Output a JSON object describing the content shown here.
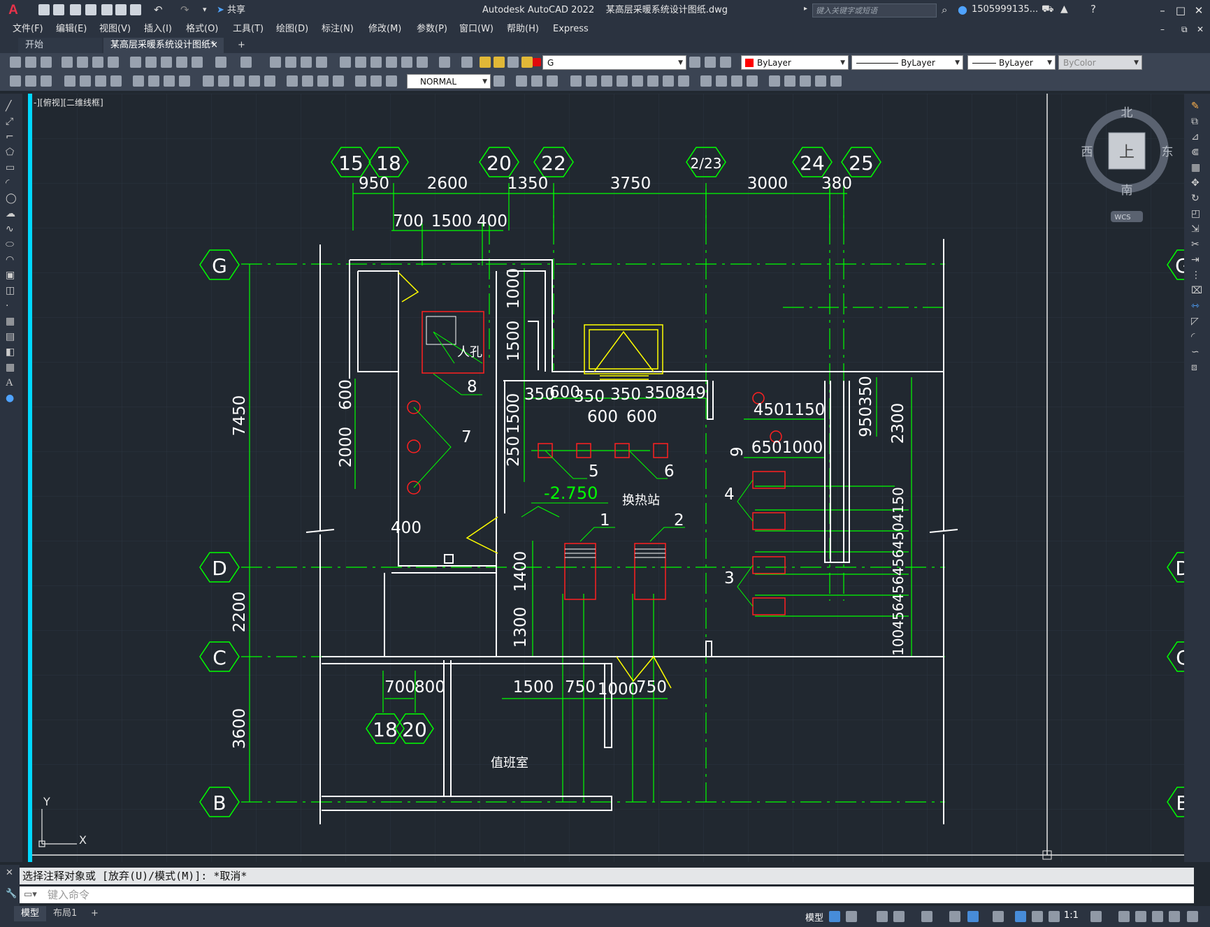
{
  "titlebar": {
    "app_title": "Autodesk AutoCAD 2022",
    "file_title": "某高层采暖系统设计图纸.dwg",
    "share_label": "共享",
    "search_placeholder": "键入关键字或短语",
    "user_name": "1505999135...",
    "app_logo": "A"
  },
  "menu": [
    "文件(F)",
    "编辑(E)",
    "视图(V)",
    "插入(I)",
    "格式(O)",
    "工具(T)",
    "绘图(D)",
    "标注(N)",
    "修改(M)",
    "参数(P)",
    "窗口(W)",
    "帮助(H)",
    "Express"
  ],
  "tabs": {
    "start": "开始",
    "active": "某高层采暖系统设计图纸*",
    "close": "×",
    "add": "+"
  },
  "toolbar": {
    "layer_value": "G",
    "color_value": "ByLayer",
    "linetype_value": "ByLayer",
    "lineweight_value": "ByLayer",
    "plotstyle_value": "ByColor",
    "dimstyle_value": "NORMAL"
  },
  "viewport_label": "-][俯视][二维线框]",
  "viewcube": {
    "north": "北",
    "south": "南",
    "east": "东",
    "west": "西",
    "top": "上",
    "wcs": "WCS"
  },
  "ucs": {
    "x": "X",
    "y": "Y"
  },
  "drawing": {
    "axis_top": [
      "15",
      "18",
      "20",
      "22",
      "2/23",
      "24",
      "25"
    ],
    "axis_left": [
      "G",
      "D",
      "C",
      "B"
    ],
    "axis_bottom": [
      "18",
      "20"
    ],
    "dims_top_row1": [
      "950",
      "2600",
      "1350",
      "3750",
      "3000",
      "380"
    ],
    "dims_top_row2": [
      "700",
      "1500",
      "400"
    ],
    "dims_left": [
      "7450",
      "2200",
      "3600"
    ],
    "dims_misc": [
      "600",
      "2000",
      "400",
      "1000",
      "1500",
      "1500",
      "250",
      "1400",
      "1300",
      "350",
      "600",
      "350",
      "350",
      "350849",
      "600",
      "600",
      "4501150",
      "6501000",
      "950350",
      "2300",
      "1004564564564504150",
      "700",
      "800",
      "1500",
      "750",
      "1000",
      "750"
    ],
    "labels": {
      "manhole": "人孔",
      "heat_station": "换热站",
      "duty_room": "值班室",
      "elevation": "-2.750"
    },
    "callouts": [
      "1",
      "2",
      "3",
      "4",
      "5",
      "6",
      "7",
      "8",
      "9"
    ],
    "right_axis": [
      "G",
      "D",
      "C",
      "B"
    ]
  },
  "command": {
    "history": "选择注释对象或 [放弃(U)/模式(M)]: *取消*",
    "input_placeholder": "键入命令"
  },
  "status": {
    "model_tab": "模型",
    "layout_tab": "布局1",
    "add_tab": "+",
    "model_label": "模型",
    "scale": "1:1"
  },
  "colors": {
    "background": "#212830",
    "dim_green": "#00ff00",
    "wall_white": "#ffffff",
    "equip_red": "#ff2020",
    "accent_cyan": "#00d8ff",
    "yellow": "#ffff00"
  }
}
